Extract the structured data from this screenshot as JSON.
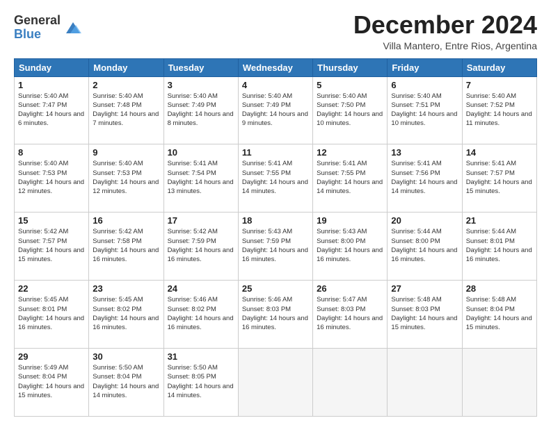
{
  "header": {
    "logo_general": "General",
    "logo_blue": "Blue",
    "title": "December 2024",
    "location": "Villa Mantero, Entre Rios, Argentina"
  },
  "days_of_week": [
    "Sunday",
    "Monday",
    "Tuesday",
    "Wednesday",
    "Thursday",
    "Friday",
    "Saturday"
  ],
  "weeks": [
    [
      {
        "day": 1,
        "sunrise": "5:40 AM",
        "sunset": "7:47 PM",
        "daylight": "14 hours and 6 minutes."
      },
      {
        "day": 2,
        "sunrise": "5:40 AM",
        "sunset": "7:48 PM",
        "daylight": "14 hours and 7 minutes."
      },
      {
        "day": 3,
        "sunrise": "5:40 AM",
        "sunset": "7:49 PM",
        "daylight": "14 hours and 8 minutes."
      },
      {
        "day": 4,
        "sunrise": "5:40 AM",
        "sunset": "7:49 PM",
        "daylight": "14 hours and 9 minutes."
      },
      {
        "day": 5,
        "sunrise": "5:40 AM",
        "sunset": "7:50 PM",
        "daylight": "14 hours and 10 minutes."
      },
      {
        "day": 6,
        "sunrise": "5:40 AM",
        "sunset": "7:51 PM",
        "daylight": "14 hours and 10 minutes."
      },
      {
        "day": 7,
        "sunrise": "5:40 AM",
        "sunset": "7:52 PM",
        "daylight": "14 hours and 11 minutes."
      }
    ],
    [
      {
        "day": 8,
        "sunrise": "5:40 AM",
        "sunset": "7:53 PM",
        "daylight": "14 hours and 12 minutes."
      },
      {
        "day": 9,
        "sunrise": "5:40 AM",
        "sunset": "7:53 PM",
        "daylight": "14 hours and 12 minutes."
      },
      {
        "day": 10,
        "sunrise": "5:41 AM",
        "sunset": "7:54 PM",
        "daylight": "14 hours and 13 minutes."
      },
      {
        "day": 11,
        "sunrise": "5:41 AM",
        "sunset": "7:55 PM",
        "daylight": "14 hours and 14 minutes."
      },
      {
        "day": 12,
        "sunrise": "5:41 AM",
        "sunset": "7:55 PM",
        "daylight": "14 hours and 14 minutes."
      },
      {
        "day": 13,
        "sunrise": "5:41 AM",
        "sunset": "7:56 PM",
        "daylight": "14 hours and 14 minutes."
      },
      {
        "day": 14,
        "sunrise": "5:41 AM",
        "sunset": "7:57 PM",
        "daylight": "14 hours and 15 minutes."
      }
    ],
    [
      {
        "day": 15,
        "sunrise": "5:42 AM",
        "sunset": "7:57 PM",
        "daylight": "14 hours and 15 minutes."
      },
      {
        "day": 16,
        "sunrise": "5:42 AM",
        "sunset": "7:58 PM",
        "daylight": "14 hours and 16 minutes."
      },
      {
        "day": 17,
        "sunrise": "5:42 AM",
        "sunset": "7:59 PM",
        "daylight": "14 hours and 16 minutes."
      },
      {
        "day": 18,
        "sunrise": "5:43 AM",
        "sunset": "7:59 PM",
        "daylight": "14 hours and 16 minutes."
      },
      {
        "day": 19,
        "sunrise": "5:43 AM",
        "sunset": "8:00 PM",
        "daylight": "14 hours and 16 minutes."
      },
      {
        "day": 20,
        "sunrise": "5:44 AM",
        "sunset": "8:00 PM",
        "daylight": "14 hours and 16 minutes."
      },
      {
        "day": 21,
        "sunrise": "5:44 AM",
        "sunset": "8:01 PM",
        "daylight": "14 hours and 16 minutes."
      }
    ],
    [
      {
        "day": 22,
        "sunrise": "5:45 AM",
        "sunset": "8:01 PM",
        "daylight": "14 hours and 16 minutes."
      },
      {
        "day": 23,
        "sunrise": "5:45 AM",
        "sunset": "8:02 PM",
        "daylight": "14 hours and 16 minutes."
      },
      {
        "day": 24,
        "sunrise": "5:46 AM",
        "sunset": "8:02 PM",
        "daylight": "14 hours and 16 minutes."
      },
      {
        "day": 25,
        "sunrise": "5:46 AM",
        "sunset": "8:03 PM",
        "daylight": "14 hours and 16 minutes."
      },
      {
        "day": 26,
        "sunrise": "5:47 AM",
        "sunset": "8:03 PM",
        "daylight": "14 hours and 16 minutes."
      },
      {
        "day": 27,
        "sunrise": "5:48 AM",
        "sunset": "8:03 PM",
        "daylight": "14 hours and 15 minutes."
      },
      {
        "day": 28,
        "sunrise": "5:48 AM",
        "sunset": "8:04 PM",
        "daylight": "14 hours and 15 minutes."
      }
    ],
    [
      {
        "day": 29,
        "sunrise": "5:49 AM",
        "sunset": "8:04 PM",
        "daylight": "14 hours and 15 minutes."
      },
      {
        "day": 30,
        "sunrise": "5:50 AM",
        "sunset": "8:04 PM",
        "daylight": "14 hours and 14 minutes."
      },
      {
        "day": 31,
        "sunrise": "5:50 AM",
        "sunset": "8:05 PM",
        "daylight": "14 hours and 14 minutes."
      },
      null,
      null,
      null,
      null
    ]
  ]
}
